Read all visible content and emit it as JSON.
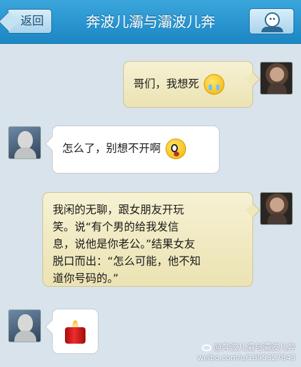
{
  "header": {
    "back_label": "返回",
    "title": "奔波儿灞与灞波儿奔"
  },
  "messages": [
    {
      "side": "right",
      "text": "哥们，我想死",
      "emoji": "crying-face"
    },
    {
      "side": "left",
      "text": "怎么了，别想不开啊",
      "emoji": "surprised-face"
    },
    {
      "side": "right",
      "lines": [
        "我闲的无聊，跟女朋友开玩",
        "笑。说“有个男的给我发信",
        "息，说他是你老公。”结果女友",
        "脱口而出：“怎么可能，他不知",
        "道你号码的。”"
      ]
    },
    {
      "side": "left",
      "emoji": "red-candle"
    }
  ],
  "watermark": {
    "line1": "@奔波儿灞与灞波儿奔",
    "line2": "weibo.com/u/1895327843"
  }
}
